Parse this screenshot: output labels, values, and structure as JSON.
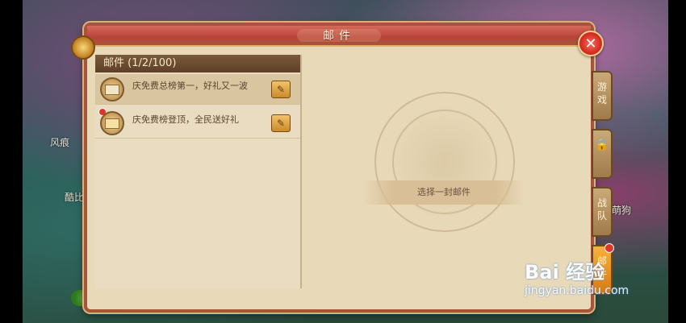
{
  "window": {
    "title": "邮件"
  },
  "mail_list": {
    "header": "邮件 (1/2/100)",
    "items": [
      {
        "subject": "庆免费总榜第一，好礼又一波",
        "unread": false,
        "selected": true,
        "has_attachment": true
      },
      {
        "subject": "庆免费榜登顶，全民送好礼",
        "unread": true,
        "selected": false,
        "has_attachment": true
      }
    ]
  },
  "detail": {
    "placeholder": "选择一封邮件"
  },
  "side_tabs": [
    {
      "label": "游戏",
      "active": false
    },
    {
      "label": "",
      "active": false,
      "icon": "lock-icon"
    },
    {
      "label": "战队",
      "active": false
    },
    {
      "label": "邮件",
      "active": true,
      "badge": true
    }
  ],
  "background_texts": {
    "left1": "风痕",
    "left2": "酷比",
    "right1": "萌狗"
  },
  "watermark": {
    "main": "Bai 经验",
    "sub": "jingyan.baidu.com"
  },
  "colors": {
    "title_bar": "#b8423a",
    "panel_bg": "#e8d9b8",
    "accent_tab": "#f7b23a"
  }
}
